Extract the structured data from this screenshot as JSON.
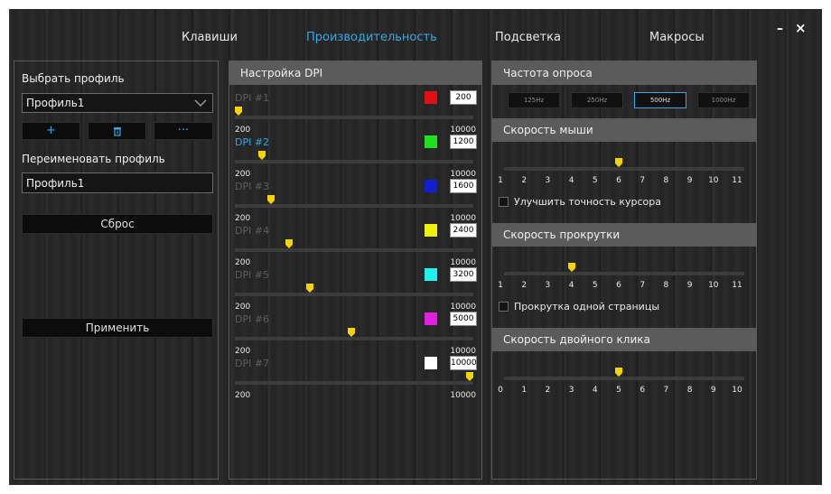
{
  "window": {
    "minimize_label": "–",
    "close_label": "×"
  },
  "tabs": [
    {
      "label": "Клавиши",
      "active": false
    },
    {
      "label": "Производительность",
      "active": true
    },
    {
      "label": "Подсветка",
      "active": false
    },
    {
      "label": "Макросы",
      "active": false
    }
  ],
  "profile": {
    "select_label": "Выбрать профиль",
    "selected": "Профиль1",
    "add_icon": "+",
    "delete_icon": "🗑",
    "more_icon": "···",
    "rename_label": "Переименовать профиль",
    "rename_value": "Профиль1",
    "reset_label": "Сброс",
    "apply_label": "Применить"
  },
  "dpi": {
    "title": "Настройка DPI",
    "min_label": "200",
    "max_label": "10000",
    "levels": [
      {
        "name": "DPI #1",
        "color": "#e01010",
        "value": "200",
        "fraction": 0.0,
        "active": false
      },
      {
        "name": "DPI #2",
        "color": "#20e020",
        "value": "1200",
        "fraction": 0.1,
        "active": true
      },
      {
        "name": "DPI #3",
        "color": "#1020d0",
        "value": "1600",
        "fraction": 0.14,
        "active": false
      },
      {
        "name": "DPI #4",
        "color": "#f0f010",
        "value": "2400",
        "fraction": 0.22,
        "active": false
      },
      {
        "name": "DPI #5",
        "color": "#20f0f0",
        "value": "3200",
        "fraction": 0.31,
        "active": false
      },
      {
        "name": "DPI #6",
        "color": "#e020e0",
        "value": "5000",
        "fraction": 0.49,
        "active": false
      },
      {
        "name": "DPI #7",
        "color": "#ffffff",
        "value": "10000",
        "fraction": 1.0,
        "active": false
      }
    ]
  },
  "polling": {
    "title": "Частота опроса",
    "options": [
      {
        "label": "125Hz",
        "active": false
      },
      {
        "label": "250Hz",
        "active": false
      },
      {
        "label": "500Hz",
        "active": true
      },
      {
        "label": "1000Hz",
        "active": false
      }
    ]
  },
  "mouse_speed": {
    "title": "Скорость мыши",
    "ticks": [
      "1",
      "2",
      "3",
      "4",
      "5",
      "6",
      "7",
      "8",
      "9",
      "10",
      "11"
    ],
    "value": 6,
    "checkbox_label": "Улучшить точность курсора"
  },
  "scroll_speed": {
    "title": "Скорость прокрутки",
    "ticks": [
      "1",
      "2",
      "3",
      "4",
      "5",
      "6",
      "7",
      "8",
      "9",
      "10",
      "11"
    ],
    "value": 4,
    "checkbox_label": "Прокрутка одной страницы"
  },
  "double_click": {
    "title": "Скорость двойного клика",
    "ticks": [
      "0",
      "1",
      "2",
      "3",
      "4",
      "5",
      "6",
      "7",
      "8",
      "9",
      "10"
    ],
    "value": 5
  }
}
